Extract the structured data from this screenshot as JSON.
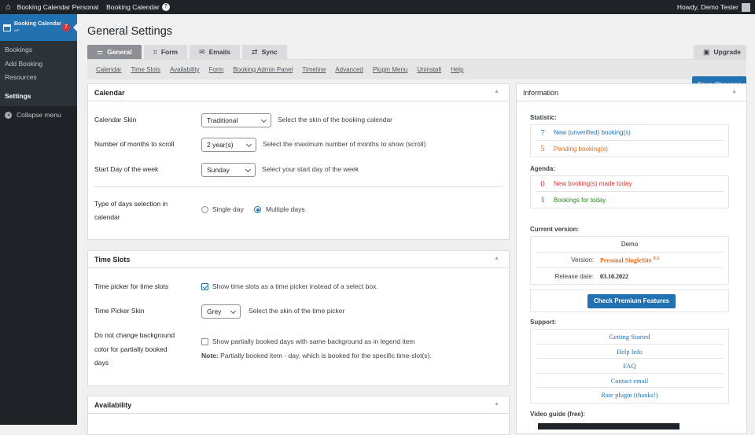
{
  "adminbar": {
    "site_name": "Booking Calendar Personal",
    "plugin_name": "Booking Calendar",
    "plugin_badge": "?",
    "greeting": "Howdy, Demo Tester"
  },
  "sidebar": {
    "current_menu": {
      "label": "Booking Calendar",
      "sublabel": "WP",
      "count": "7"
    },
    "items": [
      {
        "label": "Bookings"
      },
      {
        "label": "Add Booking"
      },
      {
        "label": "Resources"
      },
      {
        "label": "Settings"
      }
    ],
    "collapse_label": "Collapse menu"
  },
  "page": {
    "title": "General Settings"
  },
  "tabs": [
    {
      "label": "General",
      "icon": "sliders-icon"
    },
    {
      "label": "Form",
      "icon": "form-icon"
    },
    {
      "label": "Emails",
      "icon": "mail-icon"
    },
    {
      "label": "Sync",
      "icon": "sync-icon"
    }
  ],
  "upgrade_tab": {
    "label": "Upgrade",
    "icon": "lock-icon"
  },
  "subnav": [
    "Calendar",
    "Time Slots",
    "Availability",
    "Form",
    "Booking Admin Panel",
    "Timeline",
    "Advanced",
    "Plugin Menu",
    "Uninstall",
    "Help"
  ],
  "save_button": "Save Changes",
  "calendar_panel": {
    "title": "Calendar",
    "skin": {
      "label": "Calendar Skin",
      "value": "Traditional",
      "desc": "Select the skin of the booking calendar"
    },
    "months": {
      "label": "Number of months to scroll",
      "value": "2 year(s)",
      "desc": "Select the maximum number of months to show (scroll)"
    },
    "start_day": {
      "label": "Start Day of the week",
      "value": "Sunday",
      "desc": "Select your start day of the week"
    },
    "days_selection": {
      "label_line1": "Type of days selection in",
      "label_line2": "calendar",
      "option1": "Single day",
      "option2": "Multiple days",
      "selected": "Multiple days"
    }
  },
  "timeslots_panel": {
    "title": "Time Slots",
    "picker": {
      "label": "Time picker for time slots",
      "desc": "Show time slots as a time picker instead of a select box.",
      "checked": true
    },
    "picker_skin": {
      "label": "Time Picker Skin",
      "value": "Grey",
      "desc": "Select the skin of the time picker"
    },
    "background": {
      "label_line1": "Do not change background",
      "label_line2": "color for partially booked",
      "label_line3": "days",
      "desc": "Show partially booked days with same background as in legend item",
      "checked": false,
      "note_bold": "Note:",
      "note": "Partially booked item - day, which is booked for the specific time-slot(s)."
    }
  },
  "availability_panel": {
    "title": "Availability"
  },
  "info_panel": {
    "title": "Information",
    "statistic_label": "Statistic:",
    "statistic": [
      {
        "num": "7",
        "text": "New (unverified) booking(s)",
        "color": "#2271b1"
      },
      {
        "num": "5",
        "text": "Pending booking(s)",
        "color": "#e26a18"
      }
    ],
    "agenda_label": "Agenda:",
    "agenda": [
      {
        "num": "0",
        "text": "New booking(s) made today",
        "color": "#d63638"
      },
      {
        "num": "1",
        "text": "Bookings for today",
        "color": "#2b8722"
      }
    ],
    "version_label": "Current version:",
    "version_head": "Demo",
    "version_key": "Version:",
    "version_value": "Personal SingleSite",
    "version_sup": "9.3",
    "release_key": "Release date:",
    "release_value": "03.10.2022",
    "premium_button": "Check Premium Features",
    "support_label": "Support:",
    "support_links": [
      "Getting Started",
      "Help Info",
      "FAQ",
      "Contact email",
      "Rate plugin (thanks!)"
    ],
    "video_label": "Video guide (free):"
  }
}
